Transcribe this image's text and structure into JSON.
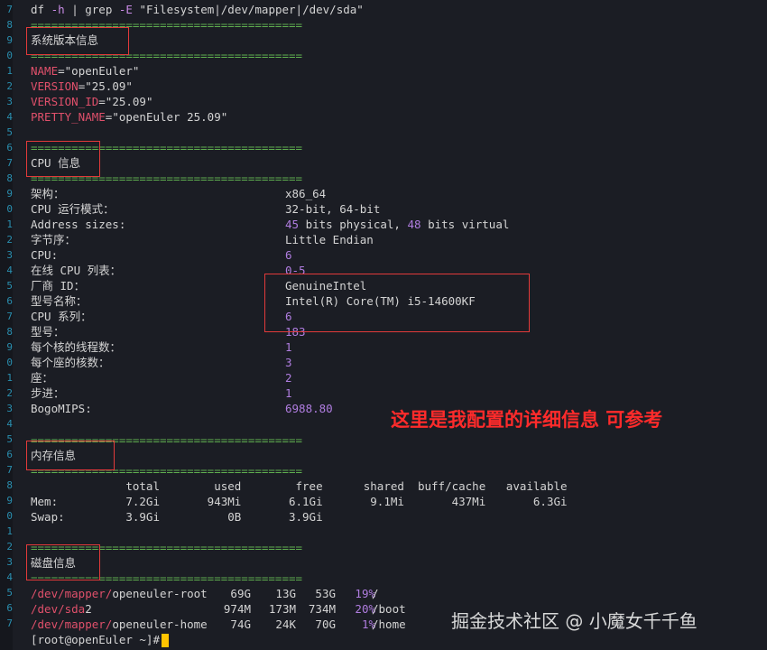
{
  "command": {
    "name": "df",
    "flag_h": "-h",
    "pipe": "| grep",
    "flag_e": "-E",
    "pattern": "\"Filesystem|/dev/mapper|/dev/sda\""
  },
  "separator": "========================================",
  "line_numbers": [
    "7",
    "8",
    "9",
    "0",
    "1",
    "2",
    "3",
    "4",
    "5",
    "6",
    "7",
    "8",
    "9",
    "0",
    "1",
    "2",
    "3",
    "4",
    "5",
    "6",
    "7",
    "8",
    "9",
    "0",
    "1",
    "2",
    "3",
    "4",
    "5",
    "6",
    "7",
    "8",
    "9",
    "0",
    "1",
    "2",
    "3",
    "4",
    "5",
    "6",
    "7"
  ],
  "sections": {
    "os": "系统版本信息",
    "cpu": "CPU 信息",
    "mem": "内存信息",
    "disk": "磁盘信息"
  },
  "os_release": [
    {
      "key": "NAME",
      "value": "\"openEuler\""
    },
    {
      "key": "VERSION",
      "value": "\"25.09\""
    },
    {
      "key": "VERSION_ID",
      "value": "\"25.09\""
    },
    {
      "key": "PRETTY_NAME",
      "value": "\"openEuler 25.09\""
    }
  ],
  "cpu_info": [
    {
      "label": "架构：",
      "value": "x86_64"
    },
    {
      "label": "CPU 运行模式：",
      "value": "32-bit, 64-bit"
    },
    {
      "label": "Address sizes:",
      "value": "45 bits physical, 48 bits virtual"
    },
    {
      "label": "字节序：",
      "value": "Little Endian"
    },
    {
      "label": "CPU:",
      "value": "6"
    },
    {
      "label": "在线 CPU 列表：",
      "value": "0-5"
    },
    {
      "label": "厂商 ID：",
      "value": "GenuineIntel"
    },
    {
      "label": "型号名称：",
      "value": "Intel(R) Core(TM) i5-14600KF"
    },
    {
      "label": "CPU 系列：",
      "value": "6"
    },
    {
      "label": "型号：",
      "value": "183"
    },
    {
      "label": "每个核的线程数：",
      "value": "1"
    },
    {
      "label": "每个座的核数：",
      "value": "3"
    },
    {
      "label": "座：",
      "value": "2"
    },
    {
      "label": "步进：",
      "value": "1"
    },
    {
      "label": "BogoMIPS:",
      "value": "6988.80"
    }
  ],
  "mem": {
    "header": "              total        used        free      shared  buff/cache   available",
    "rows": [
      "Mem:          7.2Gi       943Mi       6.1Gi       9.1Mi       437Mi       6.3Gi",
      "Swap:         3.9Gi          0B       3.9Gi"
    ]
  },
  "disk": [
    {
      "dev": "/dev/mapper/",
      "name": "openeuler-root",
      "size": "69G",
      "used": "13G",
      "avail": "53G",
      "pct": "19%",
      "mount": "/"
    },
    {
      "dev": "/dev/sda",
      "name": "2",
      "size": "974M",
      "used": "173M",
      "avail": "734M",
      "pct": "20%",
      "mount": "/boot"
    },
    {
      "dev": "/dev/mapper/",
      "name": "openeuler-home",
      "size": "74G",
      "used": "24K",
      "avail": "70G",
      "pct": "1%",
      "mount": "/home"
    }
  ],
  "prompt": "[root@openEuler ~]#",
  "annotation": "这里是我配置的详细信息 可参考",
  "watermark": "掘金技术社区 @ 小魔女千千鱼"
}
